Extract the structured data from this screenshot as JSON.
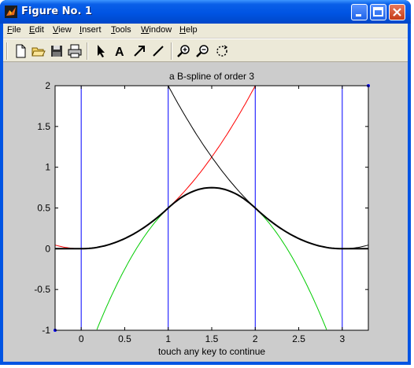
{
  "window": {
    "title": "Figure No. 1"
  },
  "menu": {
    "items": [
      {
        "label": "File"
      },
      {
        "label": "Edit"
      },
      {
        "label": "View"
      },
      {
        "label": "Insert"
      },
      {
        "label": "Tools"
      },
      {
        "label": "Window"
      },
      {
        "label": "Help"
      }
    ]
  },
  "toolbar": {
    "tools": [
      "new-file-icon",
      "open-folder-icon",
      "save-icon",
      "print-icon",
      "select-arrow-icon",
      "insert-text-icon",
      "insert-arrow-icon",
      "insert-line-icon",
      "zoom-in-icon",
      "zoom-out-icon",
      "rotate-3d-icon"
    ],
    "text_tool_glyph": "A"
  },
  "chart_data": {
    "type": "line",
    "title": "a B-spline of order 3",
    "xlabel": "touch any key to continue",
    "ylabel": "",
    "xlim": [
      -0.3,
      3.3
    ],
    "ylim": [
      -1,
      2
    ],
    "xticks": [
      "0",
      "0.5",
      "1",
      "1.5",
      "2",
      "2.5",
      "3"
    ],
    "yticks": [
      "-1",
      "-0.5",
      "0",
      "0.5",
      "1",
      "1.5",
      "2"
    ],
    "grid": false,
    "knots": [
      0,
      1,
      2,
      3
    ],
    "series": [
      {
        "color": "#ff0000",
        "description_shape": "parabola t^2/2 through (0,0),(1,0.5),(2,2)",
        "x": [
          -0.3,
          0,
          0.5,
          1,
          1.5,
          2
        ],
        "y": [
          0.045,
          0,
          0.125,
          0.5,
          1.125,
          2
        ]
      },
      {
        "color": "#00cc00",
        "description_shape": "parabola -(t-1.5)^2+0.75",
        "x": [
          0.18,
          0.5,
          1,
          1.5,
          2,
          2.5,
          2.82
        ],
        "y": [
          -1,
          -0.25,
          0.5,
          0.75,
          0.5,
          -0.25,
          -1
        ]
      },
      {
        "color": "#000000",
        "description_shape": "parabola (3-t)^2/2 through (1,2),(2,0.5),(3,0)",
        "x": [
          1,
          1.5,
          2,
          2.5,
          3,
          3.3
        ],
        "y": [
          2,
          1.125,
          0.5,
          0.125,
          0,
          0.045
        ]
      },
      {
        "color": "#000000",
        "width": 2,
        "description_shape": "composite B-spline",
        "x": [
          -0.3,
          0,
          0.25,
          0.5,
          0.75,
          1,
          1.25,
          1.5,
          1.75,
          2,
          2.25,
          2.5,
          2.75,
          3,
          3.3
        ],
        "y": [
          0,
          0,
          0.03125,
          0.125,
          0.28125,
          0.5,
          0.6875,
          0.75,
          0.6875,
          0.5,
          0.28125,
          0.125,
          0.03125,
          0,
          0
        ]
      }
    ],
    "markers": [
      {
        "x": -0.3,
        "y": -1,
        "color": "#0000ff"
      },
      {
        "x": 3.3,
        "y": 2,
        "color": "#0000ff"
      }
    ],
    "vlines_color": "#0000ff"
  }
}
